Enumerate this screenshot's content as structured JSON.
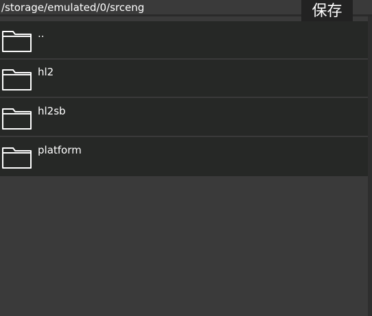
{
  "header": {
    "path": "/storage/emulated/0/srceng",
    "save_label": "保存"
  },
  "files": {
    "items": [
      {
        "label": "..",
        "icon": "folder-icon"
      },
      {
        "label": "hl2",
        "icon": "folder-icon"
      },
      {
        "label": "hl2sb",
        "icon": "folder-icon"
      },
      {
        "label": "platform",
        "icon": "folder-icon"
      }
    ]
  },
  "colors": {
    "background": "#3a3a3a",
    "list_background": "#262826",
    "button_background": "#222222",
    "text": "#ffffff"
  }
}
